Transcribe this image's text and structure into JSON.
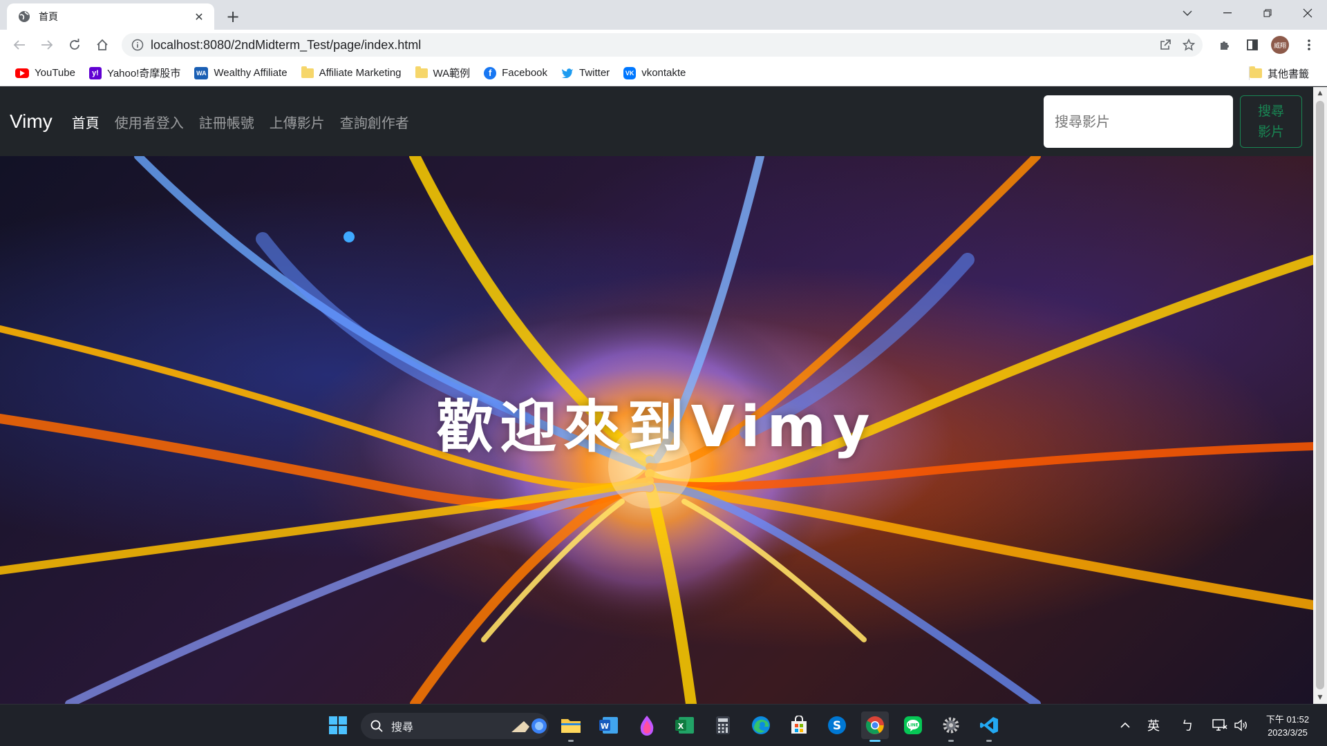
{
  "browser": {
    "tab_title": "首頁",
    "url": "localhost:8080/2ndMidterm_Test/page/index.html",
    "profile_initials": "威翔"
  },
  "bookmarks": {
    "items": [
      {
        "label": "YouTube",
        "icon": "youtube-icon",
        "color": "#ff0000"
      },
      {
        "label": "Yahoo!奇摩股市",
        "icon": "yahoo-icon",
        "color": "#6001d2"
      },
      {
        "label": "Wealthy Affiliate",
        "icon": "wealthy-affiliate-icon",
        "color": "#1a5fb4"
      },
      {
        "label": "Affiliate Marketing",
        "icon": "folder-icon"
      },
      {
        "label": "WA範例",
        "icon": "folder-icon"
      },
      {
        "label": "Facebook",
        "icon": "facebook-icon",
        "color": "#1877f2"
      },
      {
        "label": "Twitter",
        "icon": "twitter-icon",
        "color": "#1d9bf0"
      },
      {
        "label": "vkontakte",
        "icon": "vk-icon",
        "color": "#0077ff"
      }
    ],
    "other": "其他書籤"
  },
  "site": {
    "brand": "Vimy",
    "nav": [
      "首頁",
      "使用者登入",
      "註冊帳號",
      "上傳影片",
      "查詢創作者"
    ],
    "active_nav": "首頁",
    "search_placeholder": "搜尋影片",
    "search_button": "搜尋影片",
    "search_button_line1": "搜尋",
    "search_button_line2": "影片",
    "hero_title": "歡迎來到Vimy",
    "accent_color": "#198754"
  },
  "taskbar": {
    "search_label": "搜尋",
    "apps": [
      "windows-start-icon",
      "file-explorer-icon",
      "word-icon",
      "paint-icon",
      "excel-icon",
      "calculator-icon",
      "edge-icon",
      "store-icon",
      "skype-icon",
      "chrome-icon",
      "line-icon",
      "settings-icon",
      "vscode-icon"
    ],
    "ime_lang": "英",
    "ime_mode": "ㄅ",
    "time": "下午 01:52",
    "date": "2023/3/25"
  }
}
